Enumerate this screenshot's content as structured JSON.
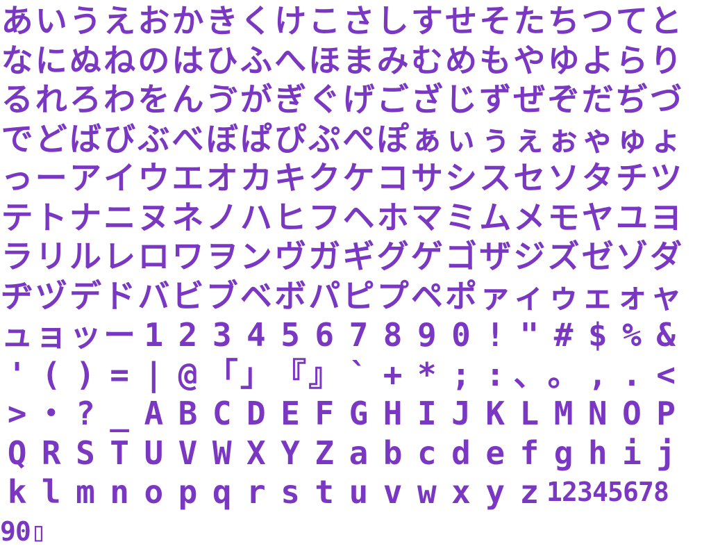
{
  "sheet": {
    "color": "#7a38c2",
    "background": "#ffffff",
    "rows": [
      [
        "あ",
        "い",
        "う",
        "え",
        "お",
        "か",
        "き",
        "く",
        "け",
        "こ",
        "さ",
        "し",
        "す",
        "せ",
        "そ",
        "た",
        "ち",
        "つ",
        "て",
        "と"
      ],
      [
        "な",
        "に",
        "ぬ",
        "ね",
        "の",
        "は",
        "ひ",
        "ふ",
        "へ",
        "ほ",
        "ま",
        "み",
        "む",
        "め",
        "も",
        "や",
        "ゆ",
        "よ",
        "ら",
        "り"
      ],
      [
        "る",
        "れ",
        "ろ",
        "わ",
        "を",
        "ん",
        "ゔ",
        "が",
        "ぎ",
        "ぐ",
        "げ",
        "ご",
        "ざ",
        "じ",
        "ず",
        "ぜ",
        "ぞ",
        "だ",
        "ぢ",
        "づ"
      ],
      [
        "で",
        "ど",
        "ば",
        "び",
        "ぶ",
        "べ",
        "ぼ",
        "ぱ",
        "ぴ",
        "ぷ",
        "ぺ",
        "ぽ",
        "ぁ",
        "ぃ",
        "ぅ",
        "ぇ",
        "ぉ",
        "ゃ",
        "ゅ",
        "ょ"
      ],
      [
        "っ",
        "ー",
        "ア",
        "イ",
        "ウ",
        "エ",
        "オ",
        "カ",
        "キ",
        "ク",
        "ケ",
        "コ",
        "サ",
        "シ",
        "ス",
        "セ",
        "ソ",
        "タ",
        "チ",
        "ツ"
      ],
      [
        "テ",
        "ト",
        "ナ",
        "ニ",
        "ヌ",
        "ネ",
        "ノ",
        "ハ",
        "ヒ",
        "フ",
        "ヘ",
        "ホ",
        "マ",
        "ミ",
        "ム",
        "メ",
        "モ",
        "ヤ",
        "ユ",
        "ヨ"
      ],
      [
        "ラ",
        "リ",
        "ル",
        "レ",
        "ロ",
        "ワ",
        "ヲ",
        "ン",
        "ヴ",
        "ガ",
        "ギ",
        "グ",
        "ゲ",
        "ゴ",
        "ザ",
        "ジ",
        "ズ",
        "ゼ",
        "ゾ",
        "ダ"
      ],
      [
        "ヂ",
        "ヅ",
        "デ",
        "ド",
        "バ",
        "ビ",
        "ブ",
        "ベ",
        "ボ",
        "パ",
        "ピ",
        "プ",
        "ペ",
        "ポ",
        "ァ",
        "ィ",
        "ゥ",
        "ェ",
        "ォ",
        "ャ"
      ],
      [
        "ュ",
        "ョ",
        "ッ",
        "ー",
        "1",
        "2",
        "3",
        "4",
        "5",
        "6",
        "7",
        "8",
        "9",
        "0",
        "!",
        "\"",
        "#",
        "$",
        "%",
        "&"
      ],
      [
        "'",
        "(",
        ")",
        "=",
        "|",
        "@",
        "「",
        "」",
        "『",
        "』",
        "`",
        "+",
        "*",
        ";",
        ":",
        "、",
        "。",
        ",",
        ".",
        "<"
      ],
      [
        ">",
        "・",
        "?",
        "_",
        "A",
        "B",
        "C",
        "D",
        "E",
        "F",
        "G",
        "H",
        "I",
        "J",
        "K",
        "L",
        "M",
        "N",
        "O",
        "P"
      ],
      [
        "Q",
        "R",
        "S",
        "T",
        "U",
        "V",
        "W",
        "X",
        "Y",
        "Z",
        "a",
        "b",
        "c",
        "d",
        "e",
        "f",
        "g",
        "h",
        "i",
        "j"
      ],
      [
        "k",
        "l",
        "m",
        "n",
        "o",
        "p",
        "q",
        "r",
        "s",
        "t",
        "u",
        "v",
        "w",
        "x",
        "y",
        "z",
        "1",
        "2",
        "3",
        "4",
        "5",
        "6",
        "7",
        "8"
      ],
      [
        "9",
        "0",
        "▯"
      ]
    ]
  }
}
